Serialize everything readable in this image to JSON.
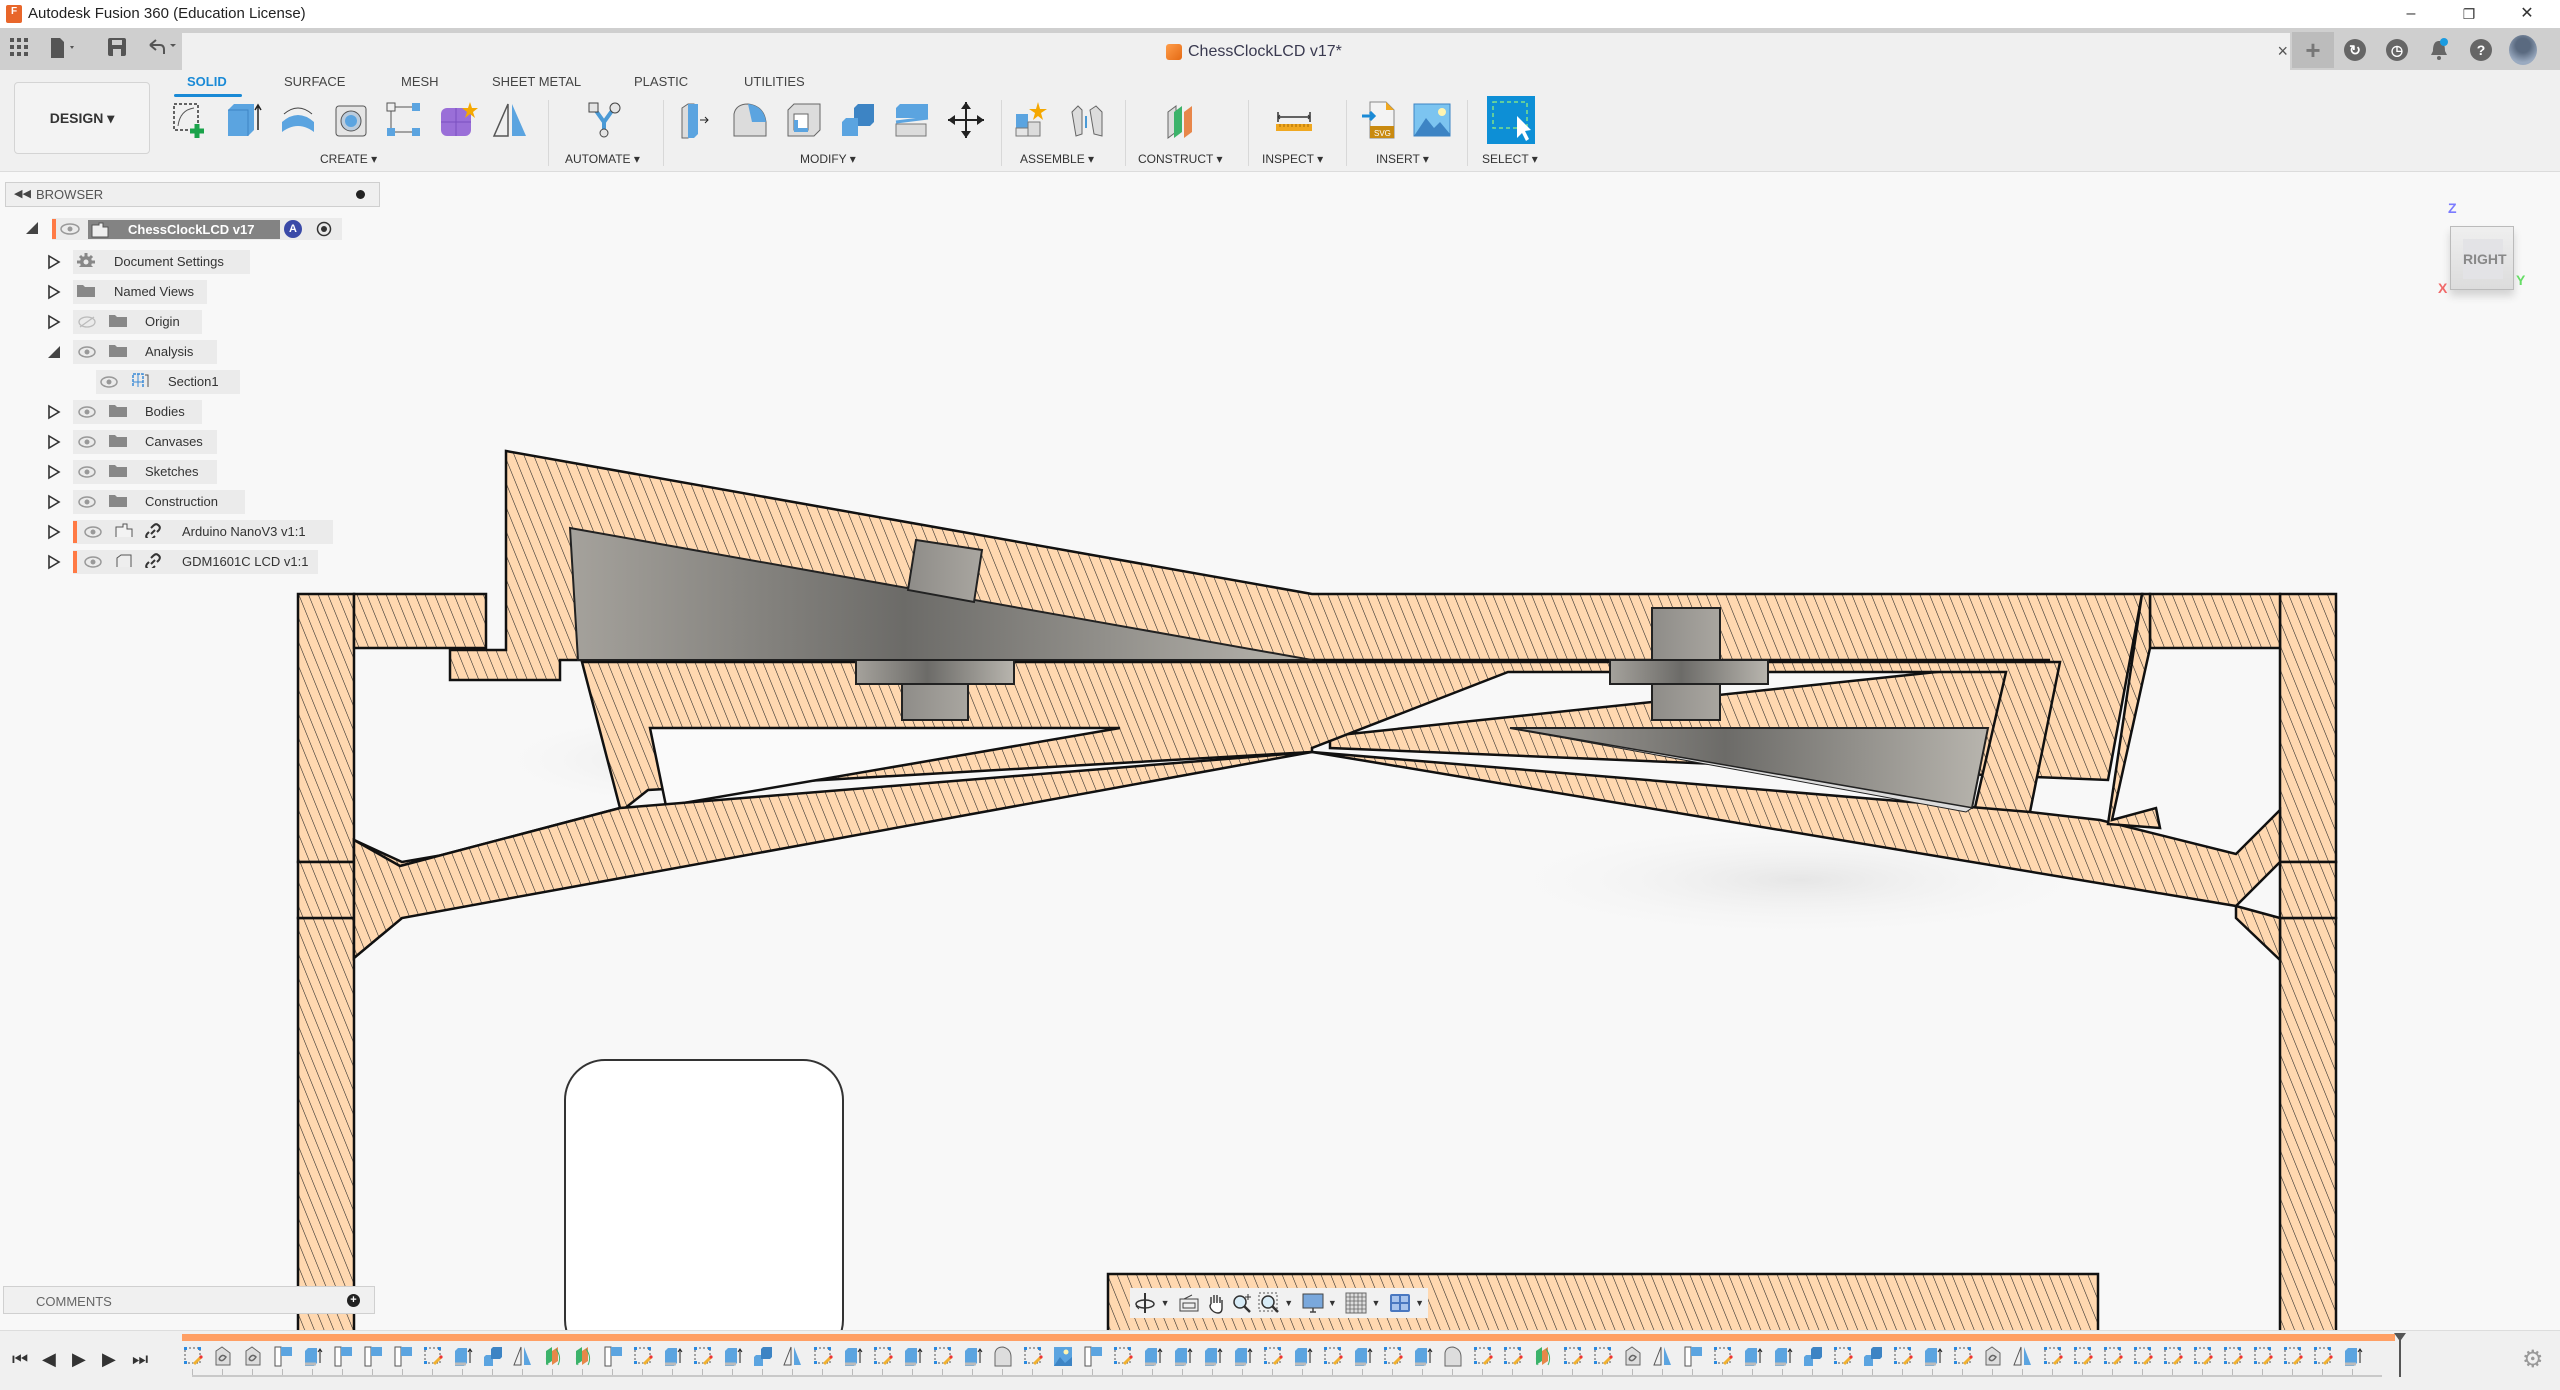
{
  "window": {
    "app_title": "Autodesk Fusion 360 (Education License)",
    "minimize": "–",
    "restore": "❐",
    "close": "✕"
  },
  "quick_access": {
    "grid_icon": "grid-icon",
    "file_icon": "file-icon",
    "save_icon": "save-icon",
    "undo_icon": "undo-icon",
    "redo_icon": "redo-icon"
  },
  "document_tab": {
    "name": "ChessClockLCD v17*",
    "close": "×"
  },
  "header_right_icons": [
    "new-tab-icon",
    "job-status-icon",
    "clock-icon",
    "notification-icon",
    "help-icon",
    "profile-avatar"
  ],
  "workspace": {
    "label": "DESIGN ▾"
  },
  "ribbon": {
    "tabs": [
      {
        "label": "SOLID",
        "active": true
      },
      {
        "label": "SURFACE",
        "active": false
      },
      {
        "label": "MESH",
        "active": false
      },
      {
        "label": "SHEET METAL",
        "active": false
      },
      {
        "label": "PLASTIC",
        "active": false
      },
      {
        "label": "UTILITIES",
        "active": false
      }
    ],
    "groups": [
      {
        "label": "CREATE ▾",
        "tools": [
          "create-sketch",
          "extrude",
          "revolve",
          "hole",
          "rectangular-pattern",
          "create-form",
          "mirror"
        ]
      },
      {
        "label": "AUTOMATE ▾",
        "tools": [
          "automated-modeling"
        ]
      },
      {
        "label": "MODIFY ▾",
        "tools": [
          "press-pull",
          "fillet",
          "shell",
          "combine",
          "offset-face",
          "move-copy"
        ]
      },
      {
        "label": "ASSEMBLE ▾",
        "tools": [
          "new-component",
          "joint"
        ]
      },
      {
        "label": "CONSTRUCT ▾",
        "tools": [
          "offset-plane"
        ]
      },
      {
        "label": "INSPECT ▾",
        "tools": [
          "measure"
        ]
      },
      {
        "label": "INSERT ▾",
        "tools": [
          "insert-svg",
          "insert-canvas"
        ]
      },
      {
        "label": "SELECT ▾",
        "tools": [
          "select"
        ]
      }
    ]
  },
  "browser": {
    "title": "BROWSER",
    "root": {
      "label": "ChessClockLCD v17",
      "badge": "A"
    },
    "items": [
      {
        "label": "Document Settings",
        "icon": "gear-icon",
        "expanded": false,
        "visible": null
      },
      {
        "label": "Named Views",
        "icon": "folder-icon",
        "expanded": false,
        "visible": null
      },
      {
        "label": "Origin",
        "icon": "folder-icon",
        "expanded": false,
        "visible": false
      },
      {
        "label": "Analysis",
        "icon": "folder-icon",
        "expanded": true,
        "visible": true
      },
      {
        "label": "Section1",
        "icon": "section-analysis-icon",
        "expanded": null,
        "visible": true,
        "child": true
      },
      {
        "label": "Bodies",
        "icon": "folder-icon",
        "expanded": false,
        "visible": true
      },
      {
        "label": "Canvases",
        "icon": "folder-icon",
        "expanded": false,
        "visible": true
      },
      {
        "label": "Sketches",
        "icon": "folder-icon",
        "expanded": false,
        "visible": true
      },
      {
        "label": "Construction",
        "icon": "folder-icon",
        "expanded": false,
        "visible": true
      },
      {
        "label": "Arduino NanoV3 v1:1",
        "icon": "component-icon",
        "expanded": false,
        "visible": true,
        "linked": true
      },
      {
        "label": "GDM1601C LCD v1:1",
        "icon": "body-icon",
        "expanded": false,
        "visible": true,
        "linked": true
      }
    ]
  },
  "viewcube": {
    "face": "RIGHT",
    "axis_z": "Z",
    "axis_x": "X",
    "axis_y": "Y"
  },
  "comments": {
    "title": "COMMENTS",
    "add": "+"
  },
  "navbar": {
    "tools": [
      "orbit-icon",
      "look-at-icon",
      "pan-icon",
      "zoom-icon",
      "fit-icon",
      "display-settings-icon",
      "grid-settings-icon",
      "viewports-icon"
    ]
  },
  "timeline": {
    "controls": [
      "first-step",
      "previous-step",
      "play",
      "next-step",
      "last-step"
    ],
    "feature_count": 73
  },
  "colors": {
    "accent": "#1a8ad6",
    "section_fill": "#ffd8b0",
    "timeline_bar": "#ff9f64",
    "component_bar": "#ff7a45"
  }
}
